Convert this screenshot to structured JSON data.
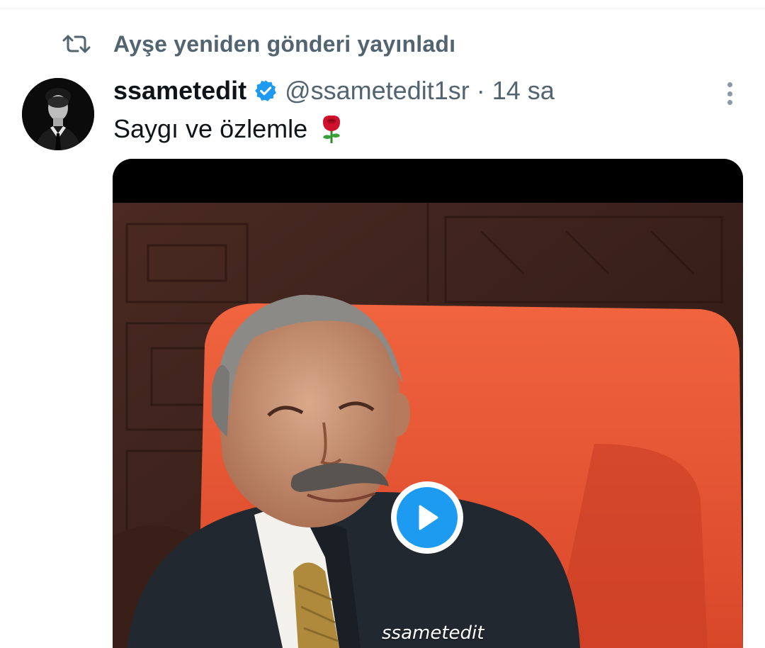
{
  "repost": {
    "text": "Ayşe yeniden gönderi yayınladı",
    "icon": "repost-icon"
  },
  "tweet": {
    "display_name": "ssametedit",
    "handle": "@ssametedit1sr",
    "separator": "·",
    "time": "14 sa",
    "text": "Saygı ve özlemle",
    "verified_icon": "verified-badge-icon",
    "emoji": "rose-icon"
  },
  "media": {
    "watermark": "ssametedit",
    "play_icon": "play-icon"
  },
  "colors": {
    "accent": "#1d9bf0",
    "text_primary": "#0f1419",
    "text_secondary": "#536471"
  }
}
